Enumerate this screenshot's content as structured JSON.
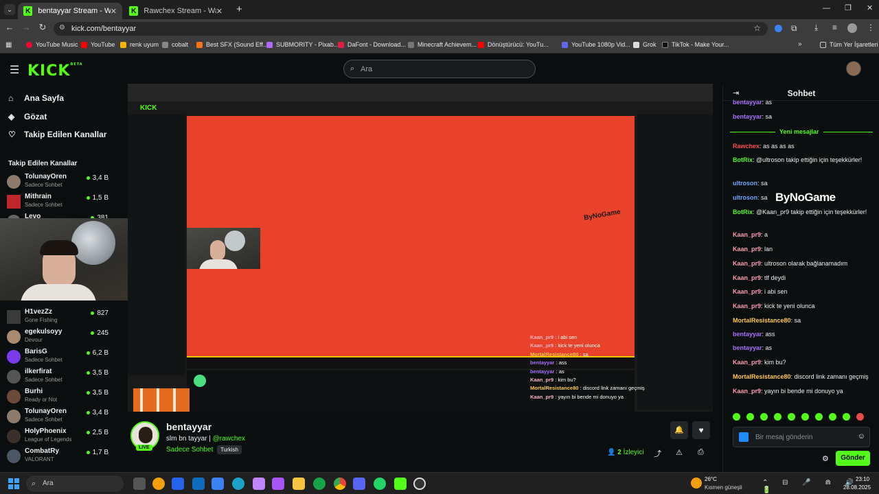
{
  "browser": {
    "tabs": [
      {
        "title": "bentayyar Stream - Watch Live",
        "active": true
      },
      {
        "title": "Rawchex Stream - Watch Live o",
        "active": false
      }
    ],
    "url": "kick.com/bentayyar",
    "bookmarks": [
      "YouTube Music",
      "YouTube",
      "renk uyum",
      "cobalt",
      "Best SFX (Sound Eff...",
      "SUBMORITY - Pixab...",
      "DaFont - Download...",
      "Minecraft Achievem...",
      "Dönüştürücü: YouTu...",
      "YouTube 1080p Vid...",
      "Grok",
      "TikTok - Make Your..."
    ],
    "all_bookmarks": "Tüm Yer İşaretleri"
  },
  "kick": {
    "logo": "KICK",
    "beta": "BETA",
    "search_placeholder": "Ara",
    "nav": [
      {
        "label": "Ana Sayfa",
        "icon": "home-icon"
      },
      {
        "label": "Gözat",
        "icon": "compass-icon"
      },
      {
        "label": "Takip Edilen Kanallar",
        "icon": "heart-icon"
      }
    ],
    "followed_header": "Takip Edilen Kanallar",
    "channels_top": [
      {
        "name": "TolunayOren",
        "cat": "Sadece Sohbet",
        "viewers": "3,4 B"
      },
      {
        "name": "Mithrain",
        "cat": "Sadece Sohbet",
        "viewers": "1,5 B"
      },
      {
        "name": "Levo",
        "cat": "",
        "viewers": "381"
      }
    ],
    "channels_bottom": [
      {
        "name": "H1vezZz",
        "cat": "Gone Fishing",
        "viewers": "827"
      },
      {
        "name": "egekulsoyy",
        "cat": "Devour",
        "viewers": "245"
      },
      {
        "name": "BarisG",
        "cat": "Sadece Sohbet",
        "viewers": "6,2 B"
      },
      {
        "name": "ilkerfirat",
        "cat": "Sadece Sohbet",
        "viewers": "3,5 B"
      },
      {
        "name": "Burhi",
        "cat": "Ready or Not",
        "viewers": "3,5 B"
      },
      {
        "name": "TolunayOren",
        "cat": "Sadece Sohbet",
        "viewers": "3,4 B"
      },
      {
        "name": "HolyPhoenix",
        "cat": "League of Legends",
        "viewers": "2,5 B"
      },
      {
        "name": "CombatRy",
        "cat": "VALORANT",
        "viewers": "1,7 B"
      }
    ],
    "streamer": {
      "name": "bentayyar",
      "title": "slm bn tayyar |",
      "mention": "@rawchex",
      "category": "Sadece Sohbet",
      "tag": "Turkish",
      "live": "LIVE",
      "viewers": "2",
      "viewers_label": "İzleyici"
    },
    "overlay_chat": [
      {
        "user": "Kaan_pr9",
        "text": "i abi sen"
      },
      {
        "user": "Kaan_pr9",
        "text": "kick te yeni olunca"
      },
      {
        "user": "MortalResistance80",
        "text": "sa"
      },
      {
        "user": "bentayyar",
        "text": "ass"
      },
      {
        "user": "bentayyar",
        "text": "as"
      },
      {
        "user": "Kaan_pr9",
        "text": "kim bu?"
      },
      {
        "user": "MortalResistance80",
        "text": "discord link zamanı geçmiş"
      },
      {
        "user": "Kaan_pr9",
        "text": "yayın bi bende mi donuyo ya"
      }
    ],
    "overlay_logo": "ByNoGame",
    "chat": {
      "title": "Sohbet",
      "new_messages": "Yeni mesajlar",
      "messages": [
        {
          "user": "bentayyar",
          "text": "as",
          "color": "#a970ff"
        },
        {
          "user": "bentayyar",
          "text": "sa",
          "color": "#a970ff"
        },
        {
          "user": "Rawchex",
          "text": "as as as as",
          "color": "#ff4d4d"
        },
        {
          "user": "BotRix",
          "text": "@ultroson takip ettiğin için teşekkürler!",
          "color": "#53fc18"
        },
        {
          "user": "ultroson",
          "text": "sa",
          "color": "#6fa8ff"
        },
        {
          "user": "ultroson",
          "text": "sa",
          "color": "#6fa8ff"
        },
        {
          "user": "BotRix",
          "text": "@Kaan_pr9 takip ettiğin için teşekkürler!",
          "color": "#53fc18"
        },
        {
          "user": "Kaan_pr9",
          "text": "a",
          "color": "#ff9bb0"
        },
        {
          "user": "Kaan_pr9",
          "text": "lan",
          "color": "#ff9bb0"
        },
        {
          "user": "Kaan_pr9",
          "text": "ultroson olarak bağlanamadım",
          "color": "#ff9bb0"
        },
        {
          "user": "Kaan_pr9",
          "text": "tlf deydi",
          "color": "#ff9bb0"
        },
        {
          "user": "Kaan_pr9",
          "text": "i abi sen",
          "color": "#ff9bb0"
        },
        {
          "user": "Kaan_pr9",
          "text": "kick te yeni olunca",
          "color": "#ff9bb0"
        },
        {
          "user": "MortalResistance80",
          "text": "sa",
          "color": "#ffc84a"
        },
        {
          "user": "bentayyar",
          "text": "ass",
          "color": "#a970ff"
        },
        {
          "user": "bentayyar",
          "text": "as",
          "color": "#a970ff"
        },
        {
          "user": "Kaan_pr9",
          "text": "kim bu?",
          "color": "#ff9bb0"
        },
        {
          "user": "MortalResistance80",
          "text": "discord link zamanı geçmiş",
          "color": "#ffc84a"
        },
        {
          "user": "Kaan_pr9",
          "text": "yayın bi bende mi donuyo ya",
          "color": "#ff9bb0"
        }
      ],
      "input_placeholder": "Bir mesaj gönderin",
      "send": "Gönder",
      "logo_text": "ByNoGame"
    }
  },
  "taskbar": {
    "search": "Ara",
    "weather_temp": "26°C",
    "weather_desc": "Kısmen güneşli",
    "time": "23:10",
    "date": "28.08.2025"
  },
  "colors": {
    "kick_green": "#53fc18",
    "stream_bg": "#e8432a",
    "page_bg": "#0b0e0f"
  }
}
